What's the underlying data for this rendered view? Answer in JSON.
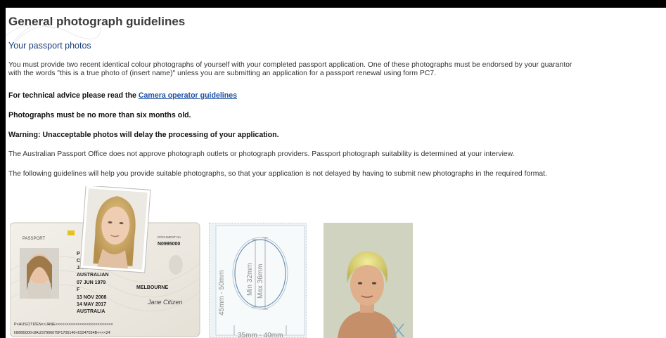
{
  "heading": "General photograph guidelines",
  "subheading": "Your passport photos",
  "intro_line1": "You must provide two recent identical colour photographs of yourself with your completed passport application. One of these photographs must be endorsed by your guarantor",
  "intro_line2": "with the words \"this is a true photo of (insert name)\" unless you are submitting an application for a passport renewal using form PC7.",
  "technical_prefix": "For technical advice please read the ",
  "technical_link": "Camera operator guidelines",
  "age_rule": "Photographs must be no more than six months old.",
  "warning": "Warning: Unacceptable photos will delay the processing of your application.",
  "office_note": "The Australian Passport Office does not approve photograph outlets or photograph providers. Passport photograph suitability is determined at your interview.",
  "guidelines_note": "The following guidelines will help you provide suitable photographs, so that your application is not delayed by having to submit new photographs in the required format.",
  "passport": {
    "label": "PASSPORT",
    "type": "P",
    "code": "CITIZ",
    "given_name": "JANE",
    "nationality": "AUSTRALIAN",
    "dob": "07 JUN 1979",
    "sex": "F",
    "issued": "13 NOV 2008",
    "expiry": "14 MAY 2017",
    "authority": "AUSTRALIA",
    "place": "MELBOURNE",
    "document_label": "DOCUMENT No",
    "document_no": "N0995000",
    "signature": "Jane Citizen",
    "mrz1": "P<AUSCITIZEN<<JANE<<<<<<<<<<<<<<<<<<<<<<<<<<",
    "mrz2": "N0995000<8AUS7906075F1705140<61047034B<<<<24"
  },
  "diagram": {
    "height_range": "45mm - 50mm",
    "min_face": "Min 32mm",
    "max_face": "Max 36mm",
    "width_range": "35mm - 40mm"
  },
  "colors": {
    "heading": "#3a3a3a",
    "subheading": "#1b3d7a",
    "link": "#1d4fa3",
    "body_text": "#333333"
  }
}
